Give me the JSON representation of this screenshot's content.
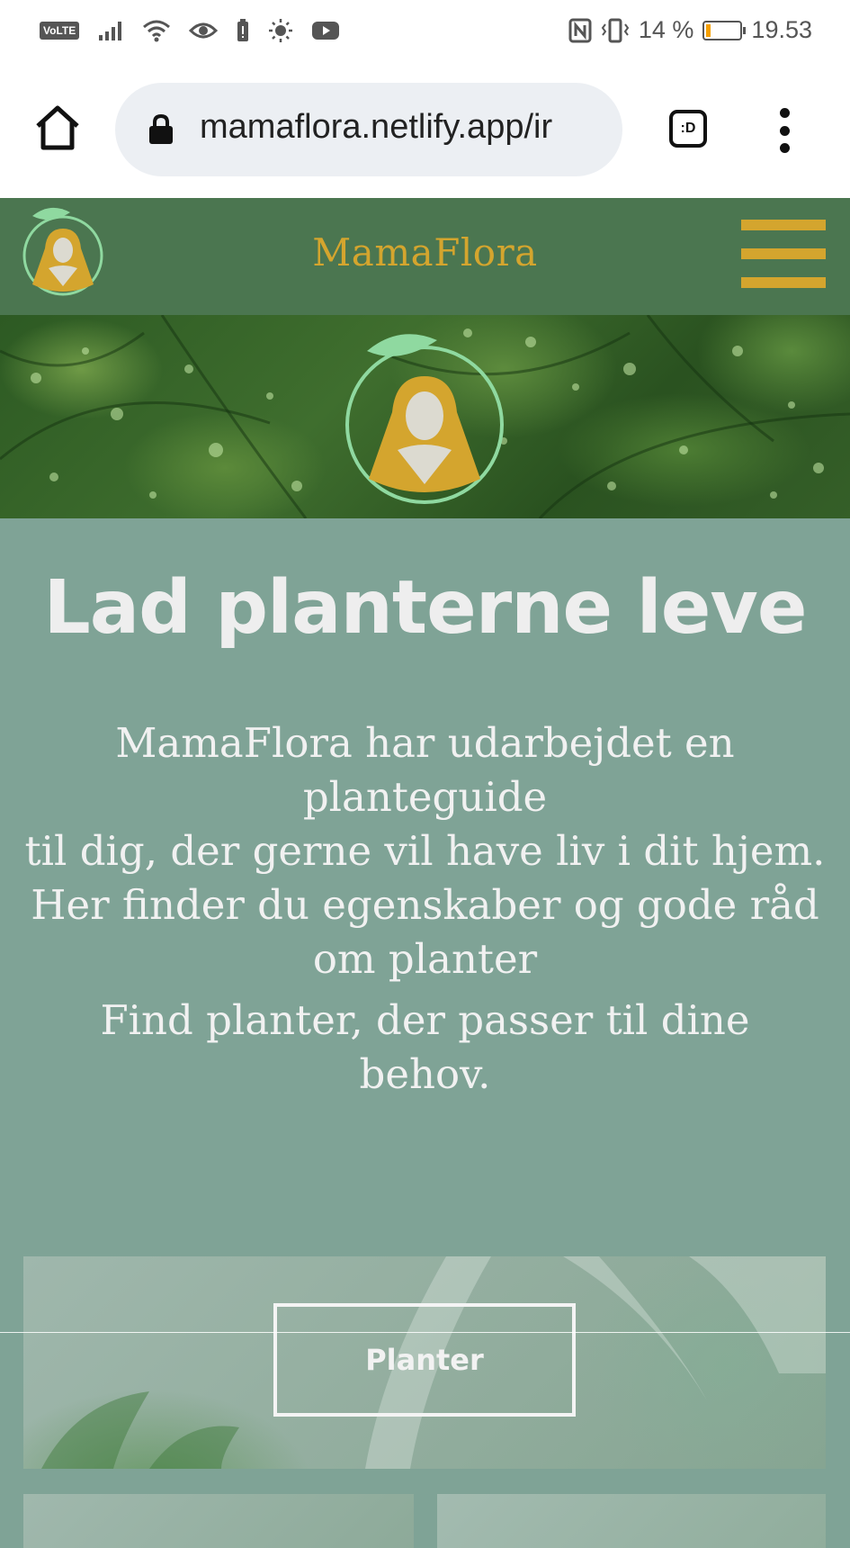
{
  "status_bar": {
    "volte": "VoLTE",
    "battery_percent": "14 %",
    "battery_level": 0.14,
    "time": "19.53"
  },
  "browser": {
    "url": "mamaflora.netlify.app/ir",
    "tab_label": ":D"
  },
  "site": {
    "brand": "MamaFlora",
    "accent_color": "#d4a52e",
    "header_color": "#4b7650",
    "background_color": "#7fa396"
  },
  "main": {
    "headline": "Lad planterne leve",
    "intro_lines": [
      "MamaFlora har udarbejdet en",
      "planteguide",
      "til dig, der gerne vil have liv i dit hjem.",
      "Her finder du egenskaber og gode råd",
      "om planter"
    ],
    "intro2_lines": [
      "Find planter, der passer til dine",
      "behov."
    ]
  },
  "cards": {
    "main_button": "Planter"
  }
}
